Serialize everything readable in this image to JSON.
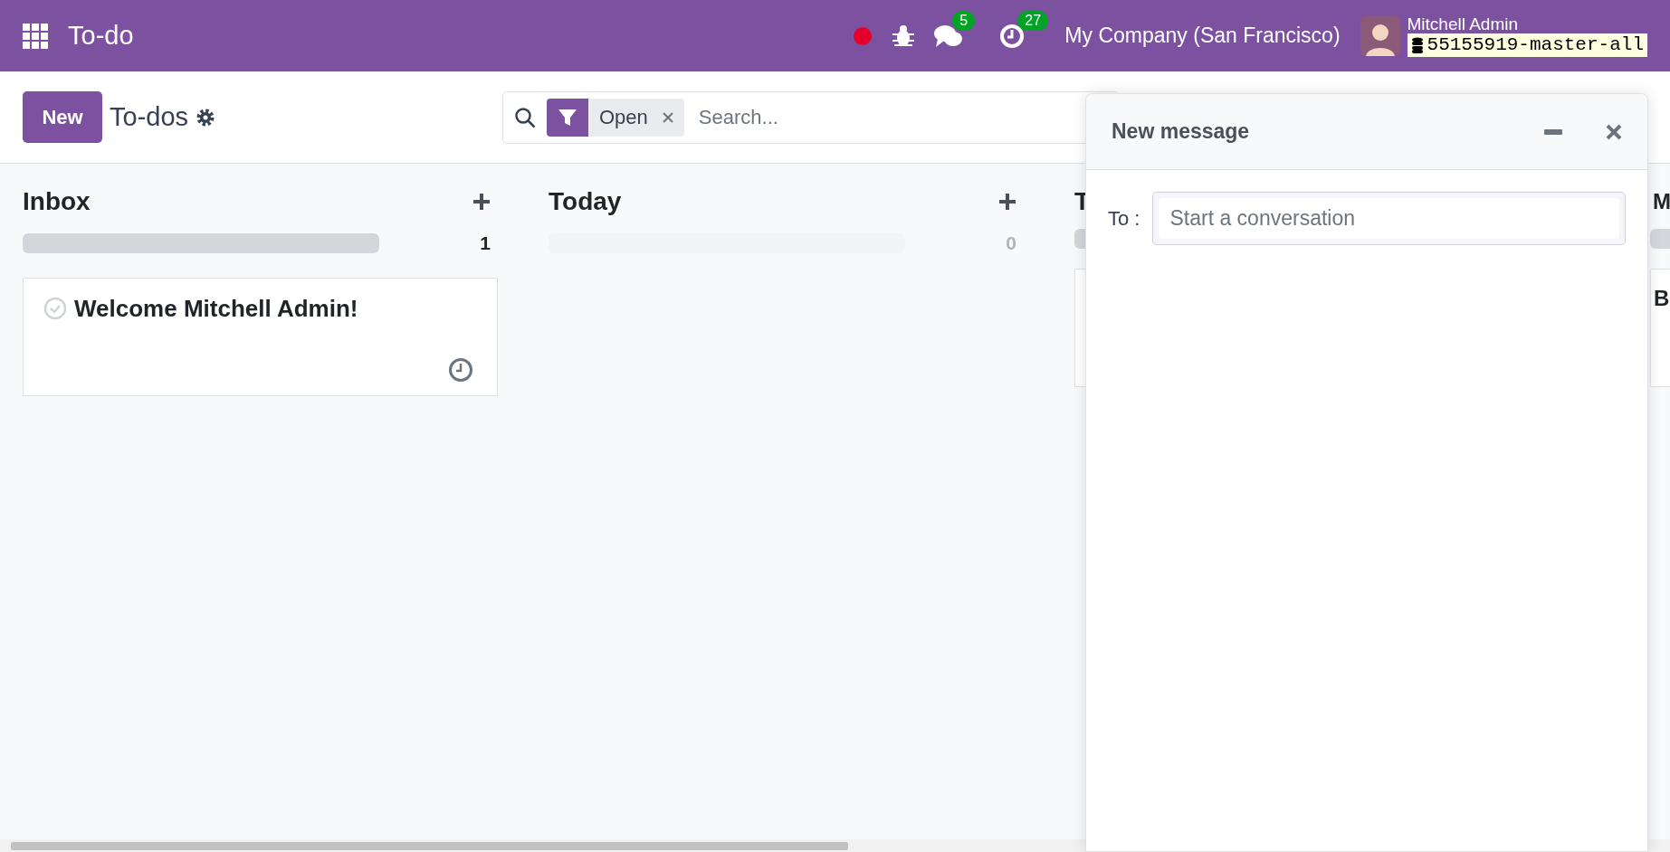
{
  "navbar": {
    "app_title": "To-do",
    "messages_count": "5",
    "activities_count": "27",
    "company": "My Company (San Francisco)",
    "user_name": "Mitchell Admin",
    "database": "55155919-master-all"
  },
  "control_panel": {
    "new_button": "New",
    "breadcrumb": "To-dos",
    "facet": "Open",
    "search_placeholder": "Search..."
  },
  "columns": [
    {
      "title": "Inbox",
      "count": "1",
      "empty": false,
      "cards": [
        {
          "kind": "todo",
          "title": "Welcome Mitchell Admin!"
        }
      ]
    },
    {
      "title": "Today",
      "count": "0",
      "empty": true
    },
    {
      "title": "T",
      "empty": false,
      "cards": [
        {
          "kind": "todo"
        }
      ]
    },
    {
      "title": "M",
      "empty": false,
      "cards": [
        {
          "kind": "todo",
          "title": "B"
        }
      ]
    }
  ],
  "chat_window": {
    "title": "New message",
    "to_label": "To :",
    "to_placeholder": "Start a conversation"
  }
}
